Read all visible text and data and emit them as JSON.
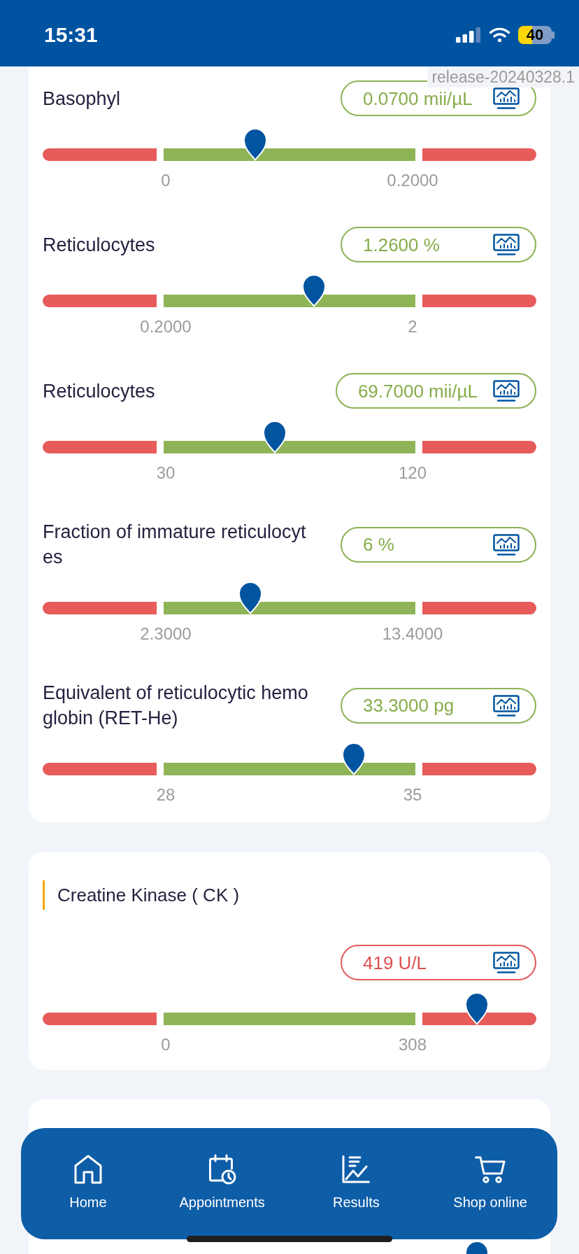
{
  "status_bar": {
    "time": "15:31",
    "battery": "40"
  },
  "version_label": "release-20240328.1",
  "cards": [
    {
      "rows": [
        {
          "label": "Basophyl",
          "value": "0.0700 mii/µL",
          "out_of_range": false,
          "low": "0",
          "high": "0.2000",
          "level": 0.43
        },
        {
          "label": "Reticulocytes",
          "value": "1.2600 %",
          "out_of_range": false,
          "low": "0.2000",
          "high": "2",
          "level": 0.55
        },
        {
          "label": "Reticulocytes",
          "value": "69.7000 mii/µL",
          "out_of_range": false,
          "low": "30",
          "high": "120",
          "level": 0.47
        },
        {
          "label": "Fraction of immature reticulocytes",
          "value": "6 %",
          "out_of_range": false,
          "low": "2.3000",
          "high": "13.4000",
          "level": 0.42
        },
        {
          "label": "Equivalent of reticulocytic hemoglobin (RET-He)",
          "value": "33.3000 pg",
          "out_of_range": false,
          "low": "28",
          "high": "35",
          "level": 0.63
        }
      ]
    },
    {
      "title": "Creatine Kinase ( CK )",
      "rows": [
        {
          "value": "419 U/L",
          "out_of_range": true,
          "low": "0",
          "high": "308",
          "level": 0.88
        }
      ]
    },
    {
      "rows": [
        {
          "level": 0.88
        }
      ]
    }
  ],
  "nav": [
    {
      "kind": "home",
      "label": "Home",
      "selected": false
    },
    {
      "kind": "appointments",
      "label": "Appointments",
      "selected": false
    },
    {
      "kind": "results",
      "label": "Results",
      "selected": false
    },
    {
      "kind": "shop",
      "label": "Shop online",
      "selected": false
    }
  ]
}
